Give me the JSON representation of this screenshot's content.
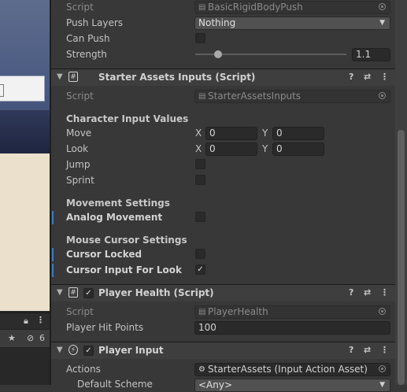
{
  "scene": {
    "visibility_count": "6",
    "lock_icon": "lock-icon",
    "star_icon": "star-icon",
    "hidden_icon": "eye-hidden-icon"
  },
  "rigidbody_push": {
    "script_label": "Script",
    "script_value": "BasicRigidBodyPush",
    "push_layers_label": "Push Layers",
    "push_layers_value": "Nothing",
    "can_push_label": "Can Push",
    "can_push_checked": false,
    "strength_label": "Strength",
    "strength_value": "1.1",
    "strength_fraction": 0.15
  },
  "starter_inputs": {
    "title": "Starter Assets Inputs (Script)",
    "script_label": "Script",
    "script_value": "StarterAssetsInputs",
    "section_character": "Character Input Values",
    "move_label": "Move",
    "look_label": "Look",
    "x_axis": "X",
    "y_axis": "Y",
    "move_x": "0",
    "move_y": "0",
    "look_x": "0",
    "look_y": "0",
    "jump_label": "Jump",
    "sprint_label": "Sprint",
    "section_movement": "Movement Settings",
    "analog_label": "Analog Movement",
    "section_mouse": "Mouse Cursor Settings",
    "cursor_locked_label": "Cursor Locked",
    "cursor_look_label": "Cursor Input For Look",
    "cursor_look_checked": true
  },
  "player_health": {
    "title": "Player Health (Script)",
    "script_label": "Script",
    "script_value": "PlayerHealth",
    "hit_points_label": "Player Hit Points",
    "hit_points_value": "100"
  },
  "player_input": {
    "title": "Player Input",
    "actions_label": "Actions",
    "actions_value": "StarterAssets (Input Action Asset)",
    "default_scheme_label": "Default Scheme",
    "default_scheme_value": "<Any>"
  },
  "header_buttons": {
    "help": "?",
    "presets": "⇄",
    "more": "⋮"
  }
}
